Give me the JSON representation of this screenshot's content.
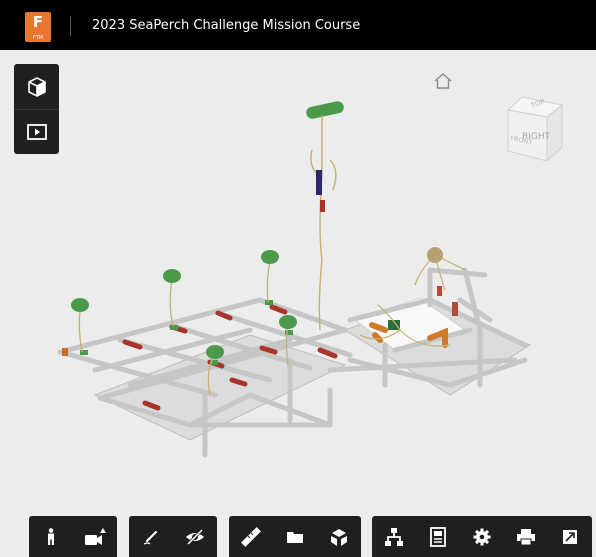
{
  "app": {
    "logo_text": "F",
    "logo_subtext": "FTM",
    "title": "2023 SeaPerch Challenge Mission Course"
  },
  "left_panel": {
    "buttons": [
      {
        "icon": "model-cube-icon"
      },
      {
        "icon": "presentation-play-icon"
      }
    ]
  },
  "viewcube": {
    "top": "TOP",
    "front": "FRONT",
    "right": "RIGHT"
  },
  "toolbar": {
    "groups": [
      [
        "person-walk-icon",
        "camera-icon"
      ],
      [
        "markup-pen-icon",
        "hide-eye-icon"
      ],
      [
        "ruler-measure-icon",
        "folder-icon",
        "explode-model-icon"
      ],
      [
        "model-browser-icon",
        "properties-icon",
        "settings-gear-icon",
        "print-icon",
        "fullscreen-icon"
      ]
    ]
  },
  "colors": {
    "header_bg": "#000000",
    "logo_orange": "#e8762c",
    "toolbar_bg": "#1f1f1f",
    "viewer_bg": "#ececec",
    "pipe_gray": "#c9c9c9",
    "float_green": "#4a9a4a",
    "marker_red": "#a8342a"
  }
}
